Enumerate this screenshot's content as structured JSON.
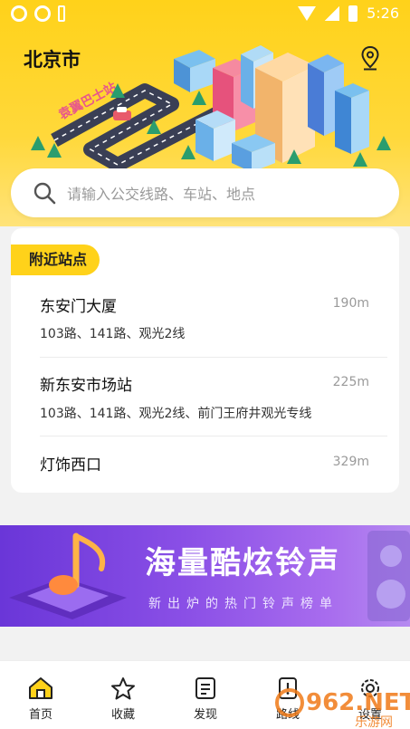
{
  "status_bar": {
    "time": "5:26"
  },
  "header": {
    "city": "北京市",
    "illustration_sign": "袁翼巴士站"
  },
  "search": {
    "placeholder": "请输入公交线路、车站、地点"
  },
  "nearby": {
    "title": "附近站点",
    "stops": [
      {
        "name": "东安门大厦",
        "distance": "190m",
        "lines": "103路、141路、观光2线"
      },
      {
        "name": "新东安市场站",
        "distance": "225m",
        "lines": "103路、141路、观光2线、前门王府井观光专线"
      },
      {
        "name": "灯饰西口",
        "distance": "329m",
        "lines": ""
      }
    ]
  },
  "banner": {
    "title": "海量酷炫铃声",
    "subtitle": "新出炉的热门铃声榜单"
  },
  "tabs": [
    {
      "label": "首页",
      "icon": "home-icon"
    },
    {
      "label": "收藏",
      "icon": "star-icon"
    },
    {
      "label": "发现",
      "icon": "list-icon"
    },
    {
      "label": "路线",
      "icon": "route-icon"
    },
    {
      "label": "设置",
      "icon": "gear-icon"
    }
  ],
  "watermark": {
    "text": "962.NET",
    "subtext": "乐游网"
  },
  "colors": {
    "accent": "#ffd21a",
    "banner": "#7a44de"
  }
}
